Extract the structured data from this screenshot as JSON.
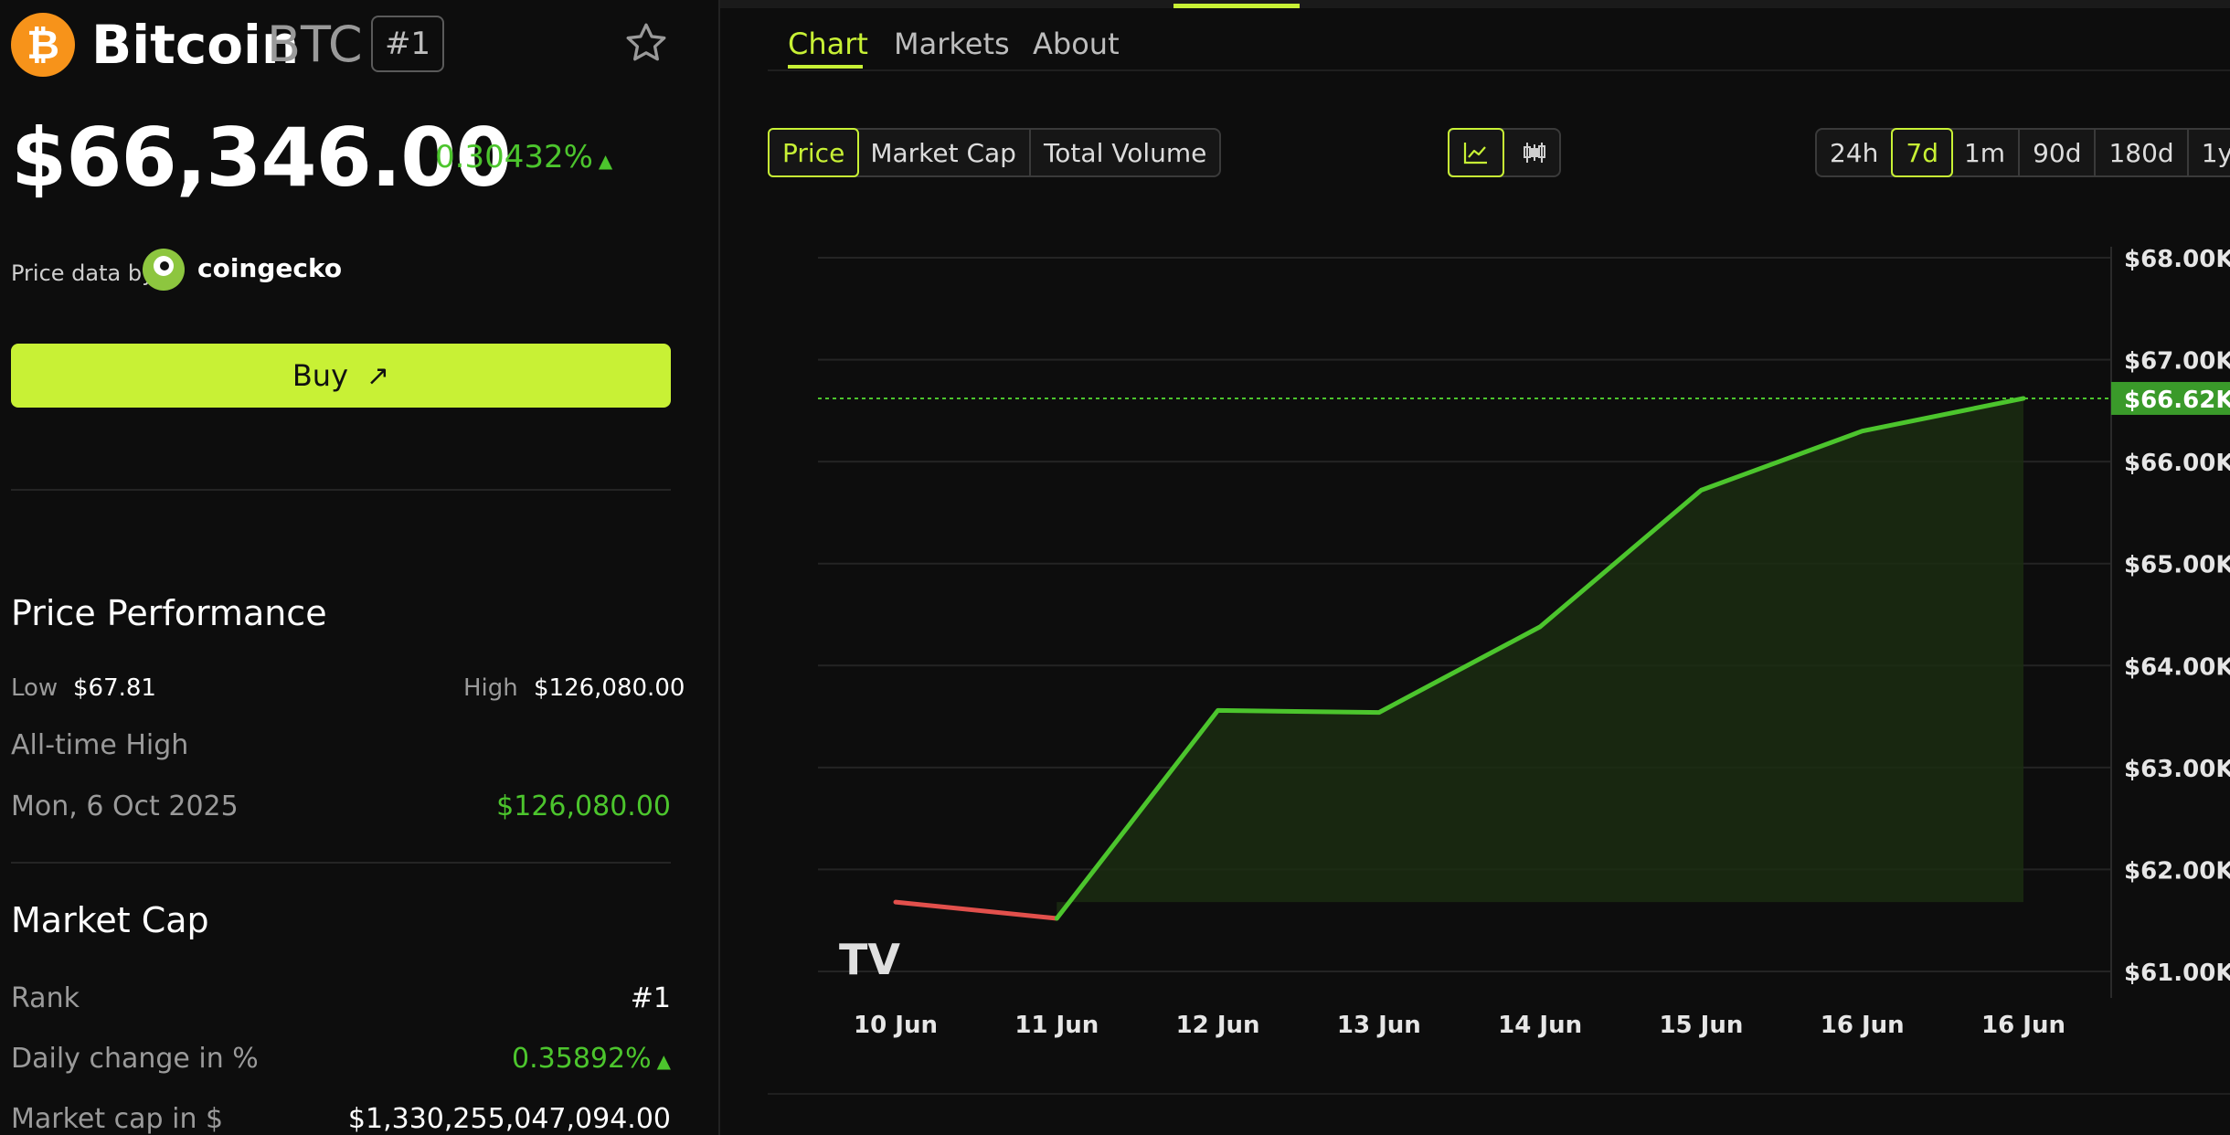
{
  "coin": {
    "name": "Bitcoin",
    "symbol": "BTC",
    "rank_badge": "#1",
    "icon": "bitcoin-icon",
    "price": "$66,346.00",
    "change": "0.30432%",
    "change_dir": "▲"
  },
  "price_source": {
    "label": "Price data by",
    "provider": "coingecko"
  },
  "buy": {
    "label": "Buy",
    "arrow": "↗"
  },
  "performance": {
    "title": "Price Performance",
    "low_label": "Low",
    "low_value": "$67.81",
    "high_label": "High",
    "high_value": "$126,080.00",
    "ath_label": "All-time High",
    "ath_date": "Mon, 6 Oct 2025",
    "ath_value": "$126,080.00"
  },
  "market_cap": {
    "title": "Market Cap",
    "rank_label": "Rank",
    "rank_value": "#1",
    "daily_label": "Daily change in %",
    "daily_value": "0.35892%",
    "daily_dir": "▲",
    "cap_label": "Market cap in $",
    "cap_value": "$1,330,255,047,094.00"
  },
  "tabs": [
    {
      "label": "Chart",
      "active": true
    },
    {
      "label": "Markets",
      "active": false
    },
    {
      "label": "About",
      "active": false
    }
  ],
  "metric_toggle": [
    {
      "label": "Price",
      "active": true
    },
    {
      "label": "Market Cap",
      "active": false
    },
    {
      "label": "Total Volume",
      "active": false
    }
  ],
  "chart_type_toggle": [
    {
      "icon": "line-chart-icon",
      "active": true
    },
    {
      "icon": "candlestick-icon",
      "active": false
    }
  ],
  "ranges": [
    {
      "label": "24h",
      "active": false
    },
    {
      "label": "7d",
      "active": true
    },
    {
      "label": "1m",
      "active": false
    },
    {
      "label": "90d",
      "active": false
    },
    {
      "label": "180d",
      "active": false
    },
    {
      "label": "1y",
      "active": false
    }
  ],
  "colors": {
    "accent": "#c8f135",
    "up": "#4cc52d",
    "down": "#e2504c",
    "bitcoin": "#f7931a"
  },
  "chart_data": {
    "type": "line",
    "x": [
      "10 Jun",
      "11 Jun",
      "12 Jun",
      "13 Jun",
      "14 Jun",
      "15 Jun",
      "16 Jun",
      "16 Jun"
    ],
    "values": [
      61680,
      61520,
      63560,
      63540,
      64380,
      65720,
      66300,
      66620
    ],
    "y_ticks": [
      "$68.00K",
      "$67.00K",
      "$66.00K",
      "$65.00K",
      "$64.00K",
      "$63.00K",
      "$62.00K",
      "$61.00K"
    ],
    "ylim": [
      61000,
      68000
    ],
    "current_label": "$66.62K",
    "current_value": 66620,
    "grid": true,
    "watermark": "TV"
  }
}
